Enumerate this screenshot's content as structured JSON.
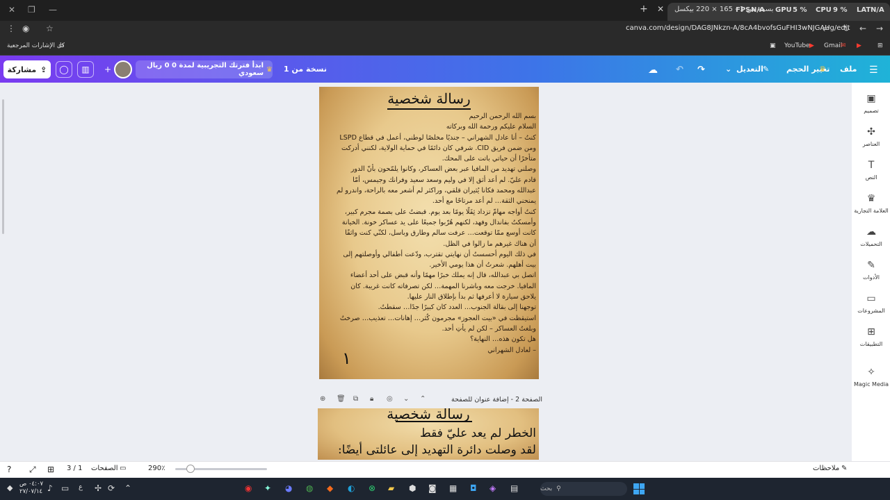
{
  "browser": {
    "tab_title": "بسمة من 1 - 165 × 220 بيكسل",
    "tab_title2": "الملف الشخصي",
    "perf": {
      "fps": "FPS",
      "fps_val": "N/A",
      "gpu": "GPU",
      "gpu_val": "5 %",
      "cpu": "CPU",
      "cpu_val": "9 %",
      "lat": "LAT",
      "lat_val": "N/A"
    },
    "url": "canva.com/design/DAG8JNkzn-A/8cA4bvofsGuFHI3wNJGAUg/edit",
    "bookmarks": {
      "all": "كل الإشارات المرجعية",
      "youtube": "YouTube",
      "gmail": "Gmail"
    }
  },
  "header": {
    "share_label": "مشاركة",
    "trial_label": "ابدأ فترتك التجريبية لمدة 0 0 ريال سعودي",
    "copy_label": "نسخة من 1",
    "menu_file": "ملف",
    "menu_resize": "تغيير الحجم",
    "menu_edit": "التعديل"
  },
  "page1": {
    "title": "رسالة شخصية",
    "lines": [
      "بسم الله الرحمن الرحيم",
      "السلام عليكم ورحمة الله وبركاته",
      "كنتُ – أنا عادل الشهراني – جنديًا مخلصًا لوطني، أعمل في قطاع LSPD",
      "ومن ضمن فريق CID. شرفي كان دائمًا في حماية الولاية، لكنني أدركت",
      "متأخرًا أن حياتي باتت على المحك.",
      "وصلني تهديد من المافيا عبر بعض العساكر، وكانوا يلمّحون بأنّ الدور",
      "قادم عليّ. لم أعد أثق إلا في وليم وسعد سعيد وفرانك وجيمس، أمّا",
      "عبدالله ومحمد فكانا يُثيران قلقي، وراكثر لم أشعر معه بالراحة، واندرو لم",
      "يمنحني الثقة… لم أعد مرتاحًا مع أحد.",
      "كنتُ أواجه مهامّ تزداد ثِقَلًا يومًا بعد يوم. قبضتُ على بصمة مجرم كبير،",
      "وأمسكتُ بفاندال وفهد، لكنهم هُرّبوا جميعًا على يد عساكر خونة. الخيانة",
      "كانت أوسع ممّا توقعت… عرفت سالم وطارق وباسل، لكنّي كنت واثقًا",
      "أن هناك غيرهم ما زالوا في الظل.",
      "في ذلك اليوم أحسستُ أن نهايتي تقترب، ودّعت أطفالي وأوصلتهم إلى",
      "بيت أهلهم. شعرتُ أن هذا يومي الأخير.",
      "اتصل بي عبدالله، قال إنه يملك خبرًا مهمًا وأنه قبض على أحد أعضاء",
      "المافيا. خرجت معه وباشرنا المهمة… لكن تصرفاته كانت غريبة. كان",
      "يلاحق سيارة لا أعرفها ثم بدأ بإطلاق النار عليها.",
      "توجهنا إلى بقالة الجنوب… العدد كان كبيرًا جدًا… سقطتُ.",
      "استيقظت في «بيت العجوز» مجرمون كُثر… إهانات… تعذيب… صرختُ",
      "وبلغتُ العساكر – لكن لم يأتِ أحد.",
      "هل تكون هذه… النهاية؟",
      "– لعادل الشهراني"
    ],
    "page_number": "١"
  },
  "page_toolbar": {
    "label": "الصفحة 2 - إضافة عنوان للصفحة"
  },
  "page2": {
    "title": "رسالة شخصية",
    "line1": "الخطر لم يعد عليّ فقط",
    "line2": "لقد وصلت دائرة التهديد إلى عائلتى أيضًا:"
  },
  "sidebar": [
    {
      "icon": "design-icon",
      "glyph": "▣",
      "label": "تصميم"
    },
    {
      "icon": "elements-icon",
      "glyph": "✣",
      "label": "العناصر"
    },
    {
      "icon": "text-icon",
      "glyph": "T",
      "label": "النص"
    },
    {
      "icon": "brand-icon",
      "glyph": "♛",
      "label": "العلامة التجارية"
    },
    {
      "icon": "uploads-icon",
      "glyph": "☁",
      "label": "التحميلات"
    },
    {
      "icon": "tools-icon",
      "glyph": "✎",
      "label": "الأدوات"
    },
    {
      "icon": "projects-icon",
      "glyph": "▭",
      "label": "المشروعات"
    },
    {
      "icon": "apps-icon",
      "glyph": "⊞",
      "label": "التطبيقات"
    },
    {
      "icon": "magic-media-icon",
      "glyph": "✧",
      "label": "Magic Media"
    }
  ],
  "footer": {
    "notes": "ملاحظات",
    "pages": "الصفحات",
    "page_count": "3 / 1",
    "zoom": "290٪"
  },
  "taskbar": {
    "search": "بحث",
    "time": "٠٤:٠٧ ص",
    "date": "٢٧/٠٧/١٤",
    "lang": "ع"
  },
  "colors": {
    "header_start": "#7a3bf0",
    "header_end": "#1fb3d8",
    "taskbar": "#1e2530"
  }
}
